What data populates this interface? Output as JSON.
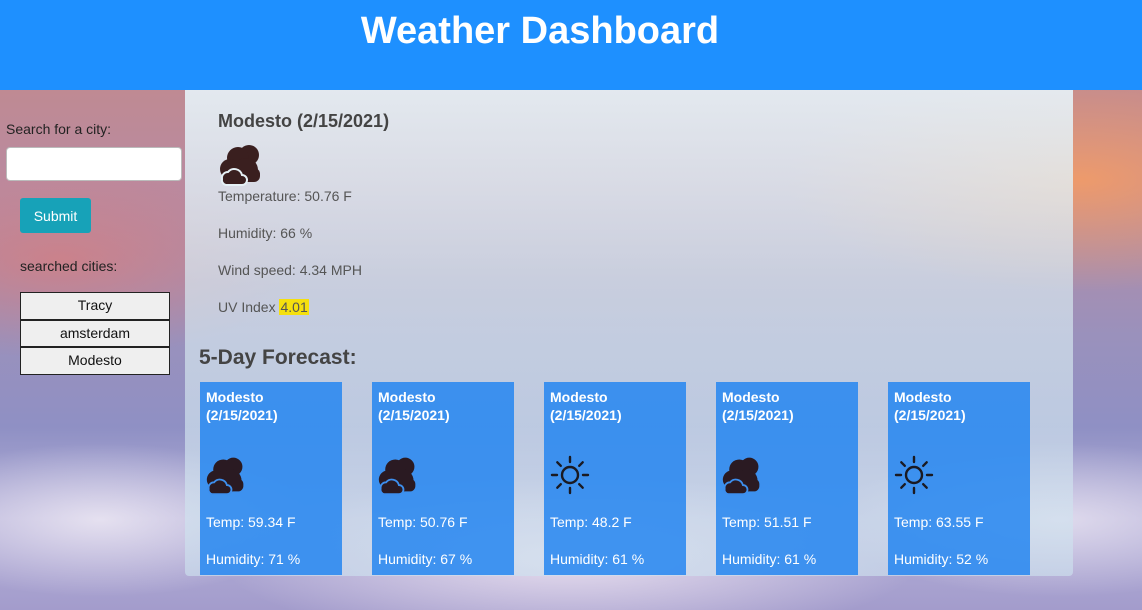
{
  "header": {
    "title": "Weather Dashboard"
  },
  "sidebar": {
    "search_label": "Search for a city:",
    "search_value": "",
    "submit_label": "Submit",
    "searched_label": "searched cities:",
    "cities": [
      "Tracy",
      "amsterdam",
      "Modesto"
    ]
  },
  "current": {
    "title": "Modesto (2/15/2021)",
    "icon": "clouds-icon",
    "temperature": "Temperature: 50.76 F",
    "humidity": "Humidity: 66 %",
    "wind": "Wind speed: 4.34 MPH",
    "uv_label": "UV Index ",
    "uv_value": "4.01",
    "uv_color": "#f5e00e"
  },
  "forecast": {
    "title": "5-Day Forecast:",
    "cards": [
      {
        "city": "Modesto",
        "date": "(2/15/2021)",
        "icon": "clouds-icon",
        "temp": "Temp: 59.34 F",
        "humidity": "Humidity: 71 %"
      },
      {
        "city": "Modesto",
        "date": "(2/15/2021)",
        "icon": "clouds-icon",
        "temp": "Temp: 50.76 F",
        "humidity": "Humidity: 67 %"
      },
      {
        "city": "Modesto",
        "date": "(2/15/2021)",
        "icon": "sun-icon",
        "temp": "Temp: 48.2 F",
        "humidity": "Humidity: 61 %"
      },
      {
        "city": "Modesto",
        "date": "(2/15/2021)",
        "icon": "clouds-icon",
        "temp": "Temp: 51.51 F",
        "humidity": "Humidity: 61 %"
      },
      {
        "city": "Modesto",
        "date": "(2/15/2021)",
        "icon": "sun-icon",
        "temp": "Temp: 63.55 F",
        "humidity": "Humidity: 52 %"
      }
    ]
  },
  "colors": {
    "header": "#1e90ff",
    "submit": "#17a2b8",
    "card": "#1e82f0"
  }
}
